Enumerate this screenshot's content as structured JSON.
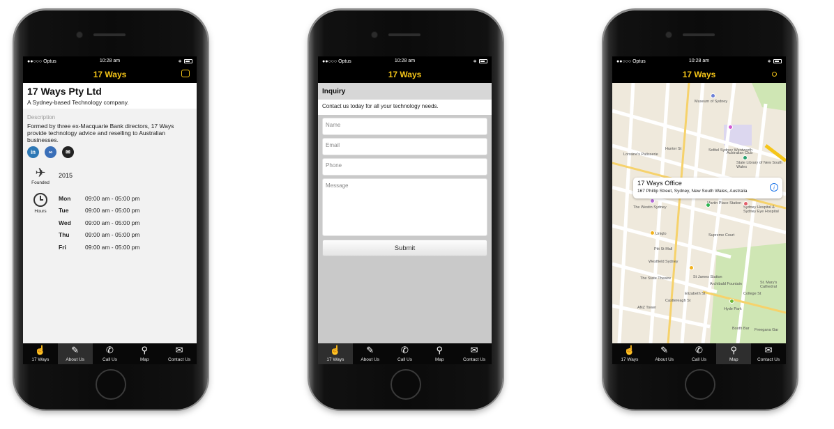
{
  "status": {
    "carrier": "●●○○○ Optus",
    "time": "10:28 am"
  },
  "nav": {
    "title": "17 Ways"
  },
  "tabs": [
    {
      "label": "17 Ways",
      "icon": "person-touch-icon"
    },
    {
      "label": "About Us",
      "icon": "quill-icon"
    },
    {
      "label": "Call Us",
      "icon": "phone-icon"
    },
    {
      "label": "Map",
      "icon": "map-pin-icon"
    },
    {
      "label": "Contact Us",
      "icon": "envelope-icon"
    }
  ],
  "about": {
    "company": "17 Ways Pty Ltd",
    "tagline": "A Sydney-based Technology company.",
    "description_label": "Description",
    "description": "Formed by three ex-Macquarie Bank directors, 17 Ways provide technology advice and reselling to Australian businesses.",
    "founded_label": "Founded",
    "founded_value": "2015",
    "hours_label": "Hours",
    "hours": [
      {
        "day": "Mon",
        "time": "09:00 am - 05:00 pm"
      },
      {
        "day": "Tue",
        "time": "09:00 am - 05:00 pm"
      },
      {
        "day": "Wed",
        "time": "09:00 am - 05:00 pm"
      },
      {
        "day": "Thu",
        "time": "09:00 am - 05:00 pm"
      },
      {
        "day": "Fri",
        "time": "09:00 am - 05:00 pm"
      }
    ]
  },
  "inquiry": {
    "title": "Inquiry",
    "subtitle": "Contact us today for all your technology needs.",
    "name_placeholder": "Name",
    "email_placeholder": "Email",
    "phone_placeholder": "Phone",
    "message_placeholder": "Message",
    "submit_label": "Submit"
  },
  "map": {
    "callout_title": "17 Ways Office",
    "callout_address": "167 Phillip Street, Sydney, New South Wales, Australia",
    "labels": {
      "museum": "Museum of Sydney",
      "state_library": "State Library of New South Wales",
      "westin": "The Westin Sydney",
      "martin_place": "Martin Place Station",
      "sydney_hospital": "Sydney Hospital & Sydney Eye Hospital",
      "pitt_st_mall": "Pitt St Mall",
      "westfield": "Westfield Sydney",
      "st_james": "St James Station",
      "state_theatre": "The State Theatre",
      "hyde_park": "Hyde Park",
      "anz_tower": "ANZ Tower",
      "uniqlo": "Uniqlo",
      "supreme_court": "Supreme Court",
      "sofitel": "Sofitel Sydney Wentworth",
      "australian_club": "Australian Club",
      "lorraine": "Lorraine's Patisserie",
      "hunter_st": "Hunter St",
      "elizabeth_st": "Elizabeth St",
      "castlereagh_st": "Castlereagh St",
      "college_st": "College St",
      "booth_bar": "Booth Bar",
      "st_marys": "St. Mary's Cathedral",
      "archibald": "Archibald Fountain",
      "freeganas": "Freegana Gar"
    }
  },
  "colors": {
    "accent": "#f5c518",
    "tab_bg": "#080808",
    "map_bg": "#efe9dc"
  }
}
